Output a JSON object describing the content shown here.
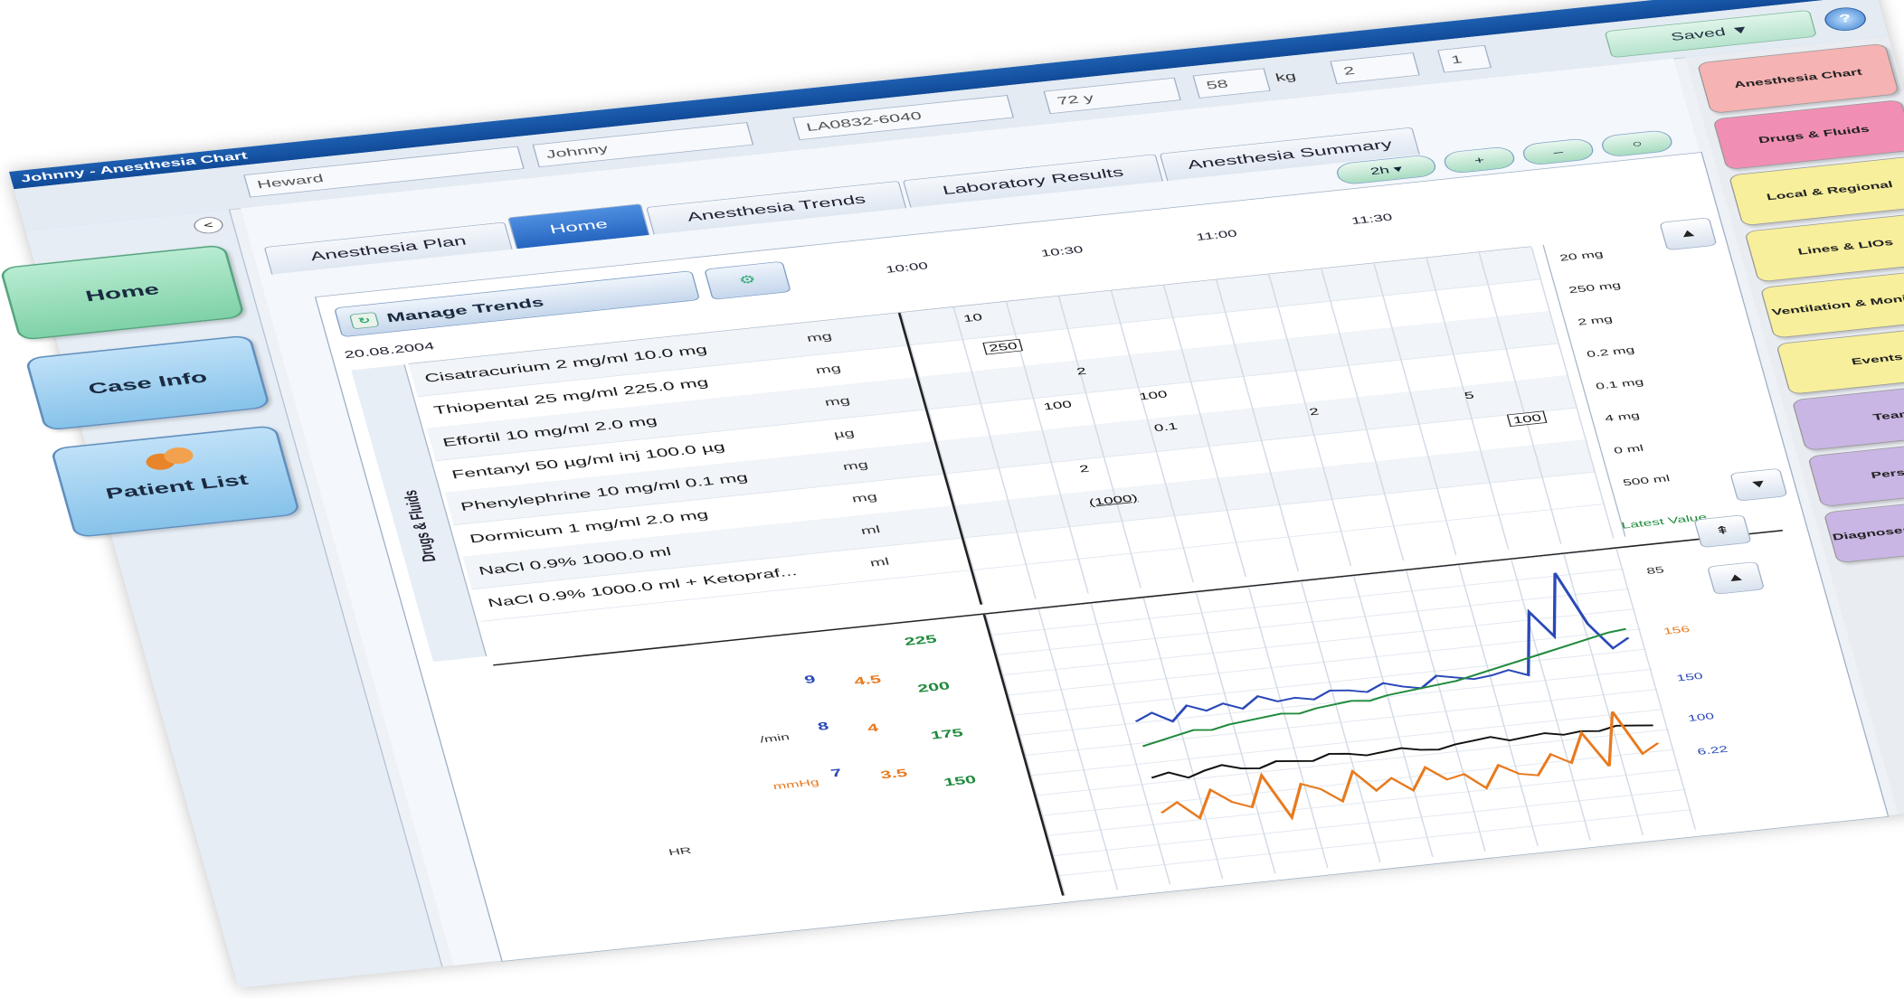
{
  "window": {
    "title": "Johnny - Anesthesia Chart",
    "control": "x"
  },
  "header": {
    "last_name": "Heward",
    "first_name": "Johnny",
    "patient_id": "LA0832-6040",
    "age": "72 y",
    "weight": "58",
    "weight_unit": "kg",
    "field_a": "2",
    "field_b": "1",
    "state": "Saved",
    "help": "?"
  },
  "left_nav": {
    "collapse": "<",
    "home": "Home",
    "case_info": "Case Info",
    "patient_list": "Patient List"
  },
  "tabs": [
    "Anesthesia Plan",
    "Home",
    "Anesthesia Trends",
    "Laboratory Results",
    "Anesthesia Summary"
  ],
  "toolbar": {
    "range": "2h ▾",
    "zoom_in": "+",
    "zoom_out": "–",
    "reset": "○"
  },
  "panel": {
    "manage_trends": "Manage Trends",
    "date": "20.08.2004",
    "times": [
      "10:00",
      "10:30",
      "11:00",
      "11:30"
    ],
    "section_label": "Drugs & Fluids"
  },
  "drugs": [
    {
      "name": "Cisatracurium 2 mg/ml 10.0 mg",
      "unit": "mg"
    },
    {
      "name": "Thiopental 25 mg/ml 225.0 mg",
      "unit": "mg"
    },
    {
      "name": "Effortil 10 mg/ml 2.0 mg",
      "unit": "mg"
    },
    {
      "name": "Fentanyl 50 µg/ml inj 100.0 µg",
      "unit": "µg"
    },
    {
      "name": "Phenylephrine 10 mg/ml 0.1 mg",
      "unit": "mg"
    },
    {
      "name": "Dormicum 1 mg/ml 2.0 mg",
      "unit": "mg"
    },
    {
      "name": "NaCl 0.9% 1000.0 ml",
      "unit": "ml"
    },
    {
      "name": "NaCl 0.9% 1000.0 ml + Ketopraf...",
      "unit": "ml"
    }
  ],
  "marks": [
    "10",
    "250",
    "2",
    "100",
    "100",
    "0.1",
    "2",
    "5",
    "100",
    "2",
    "(1000)"
  ],
  "rates": [
    "20 mg",
    "250 mg",
    "2 mg",
    "0.2 mg",
    "0.1 mg",
    "4 mg",
    "0 ml",
    "500 ml"
  ],
  "vitals": {
    "scales": {
      "blue": [
        "9",
        "8",
        "7"
      ],
      "orange": [
        "4.5",
        "4",
        "3.5"
      ],
      "green": [
        "225",
        "200",
        "175",
        "150"
      ],
      "units": [
        "/min",
        "mmHg",
        "HR"
      ]
    },
    "right_scale": [
      "Latest Value",
      "85",
      "156",
      "150",
      "100",
      "6.22"
    ],
    "colors": {
      "blue": "#2a48b8",
      "orange": "#e87a1e",
      "green": "#1f8a3c",
      "black": "#111111"
    }
  },
  "chart_data": {
    "type": "line",
    "series": [
      {
        "values": [
          92,
          96,
          90,
          98,
          94,
          97,
          93,
          99,
          95,
          96,
          94,
          98,
          97,
          95,
          99,
          96,
          94,
          100,
          98,
          96,
          97,
          99,
          95,
          130,
          115,
          150,
          120,
          105,
          110
        ]
      },
      {
        "values": [
          60,
          62,
          58,
          61,
          63,
          60,
          59,
          62,
          61,
          60,
          63,
          62,
          60,
          61,
          62,
          60,
          59,
          61,
          62,
          63,
          60,
          61,
          62,
          60,
          61,
          60,
          62,
          61,
          60
        ]
      },
      {
        "values": [
          78,
          80,
          82,
          84,
          83,
          85,
          86,
          87,
          88,
          87,
          89,
          90,
          91,
          90,
          92,
          93,
          94,
          95,
          96,
          98,
          100,
          102,
          104,
          106,
          108,
          110,
          112,
          114,
          115
        ]
      },
      {
        "values": [
          40,
          45,
          35,
          50,
          42,
          38,
          55,
          30,
          48,
          44,
          36,
          52,
          40,
          46,
          38,
          50,
          42,
          44,
          35,
          47,
          41,
          39,
          50,
          44,
          60,
          40,
          70,
          45,
          50
        ]
      }
    ]
  },
  "right_nav": [
    "Anesthesia Chart",
    "Drugs & Fluids",
    "Local & Regional",
    "Lines & LIOs",
    "Ventilation & Monitoring",
    "Events",
    "Team",
    "Personnel",
    "Diagnoses & Procedures"
  ],
  "right_colors": [
    "#f6b3b3",
    "#f08fb3",
    "#f7ef9c",
    "#f7ef9c",
    "#f7ef9c",
    "#f7ef9c",
    "#c9b6e4",
    "#c9b6e4",
    "#c9b6e4"
  ]
}
